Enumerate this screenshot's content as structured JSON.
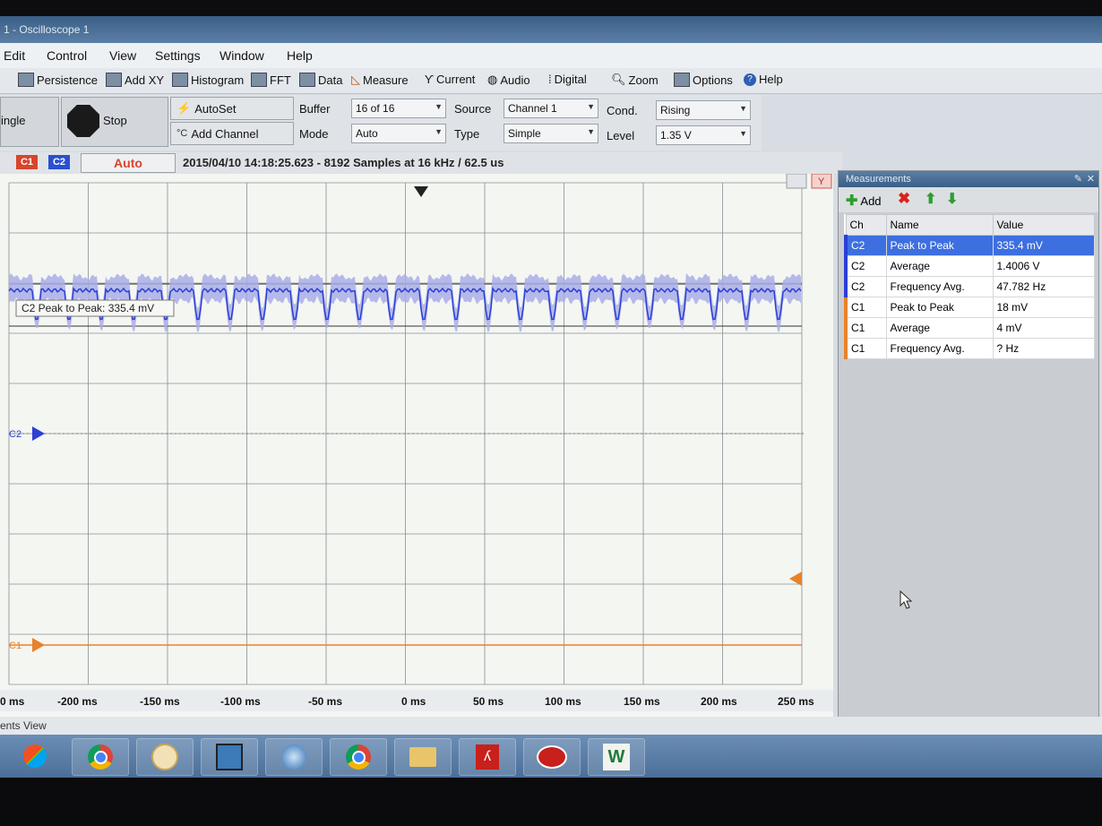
{
  "window": {
    "title": "1 - Oscilloscope 1"
  },
  "menu": [
    "Edit",
    "Control",
    "View",
    "Settings",
    "Window",
    "Help"
  ],
  "toolbar": {
    "items": [
      "Persistence",
      "Add XY",
      "Histogram",
      "FFT",
      "Data",
      "Measure",
      "Current",
      "Audio",
      "Digital",
      "Zoom",
      "Options",
      "Help"
    ]
  },
  "controls": {
    "single_label": "ingle",
    "stop_label": "Stop",
    "autoset_label": "AutoSet",
    "add_channel_label": "Add Channel",
    "buffer_label": "Buffer",
    "buffer_value": "16 of 16",
    "mode_label": "Mode",
    "mode_value": "Auto",
    "source_label": "Source",
    "source_value": "Channel 1",
    "type_label": "Type",
    "type_value": "Simple",
    "cond_label": "Cond.",
    "cond_value": "Rising",
    "level_label": "Level",
    "level_value": "1.35 V"
  },
  "status": {
    "c1": "C1",
    "c2": "C2",
    "trigger_mode": "Auto",
    "info": "2015/04/10 14:18:25.623 - 8192 Samples at 16 kHz / 62.5 us"
  },
  "plot": {
    "overlay_label": "C2 Peak to Peak: 335.4 mV",
    "c2_marker": "C2",
    "c1_marker": "C1",
    "x_ticks": [
      "0 ms",
      "-200 ms",
      "-150 ms",
      "-100 ms",
      "-50 ms",
      "0 ms",
      "50 ms",
      "100 ms",
      "150 ms",
      "200 ms",
      "250 ms"
    ],
    "colors": {
      "c1": "#e8822a",
      "c2": "#2a3fd6",
      "c2_envelope": "#a9aee8",
      "grid": "#8a8f94"
    }
  },
  "measurements": {
    "title": "Measurements",
    "add_label": "Add",
    "headers": [
      "Ch",
      "Name",
      "Value"
    ],
    "rows": [
      {
        "ch": "C2",
        "name": "Peak to Peak",
        "value": "335.4 mV"
      },
      {
        "ch": "C2",
        "name": "Average",
        "value": "1.4006 V"
      },
      {
        "ch": "C2",
        "name": "Frequency Avg.",
        "value": "47.782 Hz"
      },
      {
        "ch": "C1",
        "name": "Peak to Peak",
        "value": "18 mV"
      },
      {
        "ch": "C1",
        "name": "Average",
        "value": "4 mV"
      },
      {
        "ch": "C1",
        "name": "Frequency Avg.",
        "value": "? Hz"
      }
    ]
  },
  "bottom": {
    "label": "ents View"
  },
  "taskbar": {
    "items": [
      "windows-icon",
      "chrome-icon",
      "clock-gadget-icon",
      "app-icon",
      "thunderbird-icon",
      "chrome-icon",
      "file-explorer-icon",
      "acrobat-icon",
      "scope-app-icon",
      "waveforms-icon"
    ]
  }
}
